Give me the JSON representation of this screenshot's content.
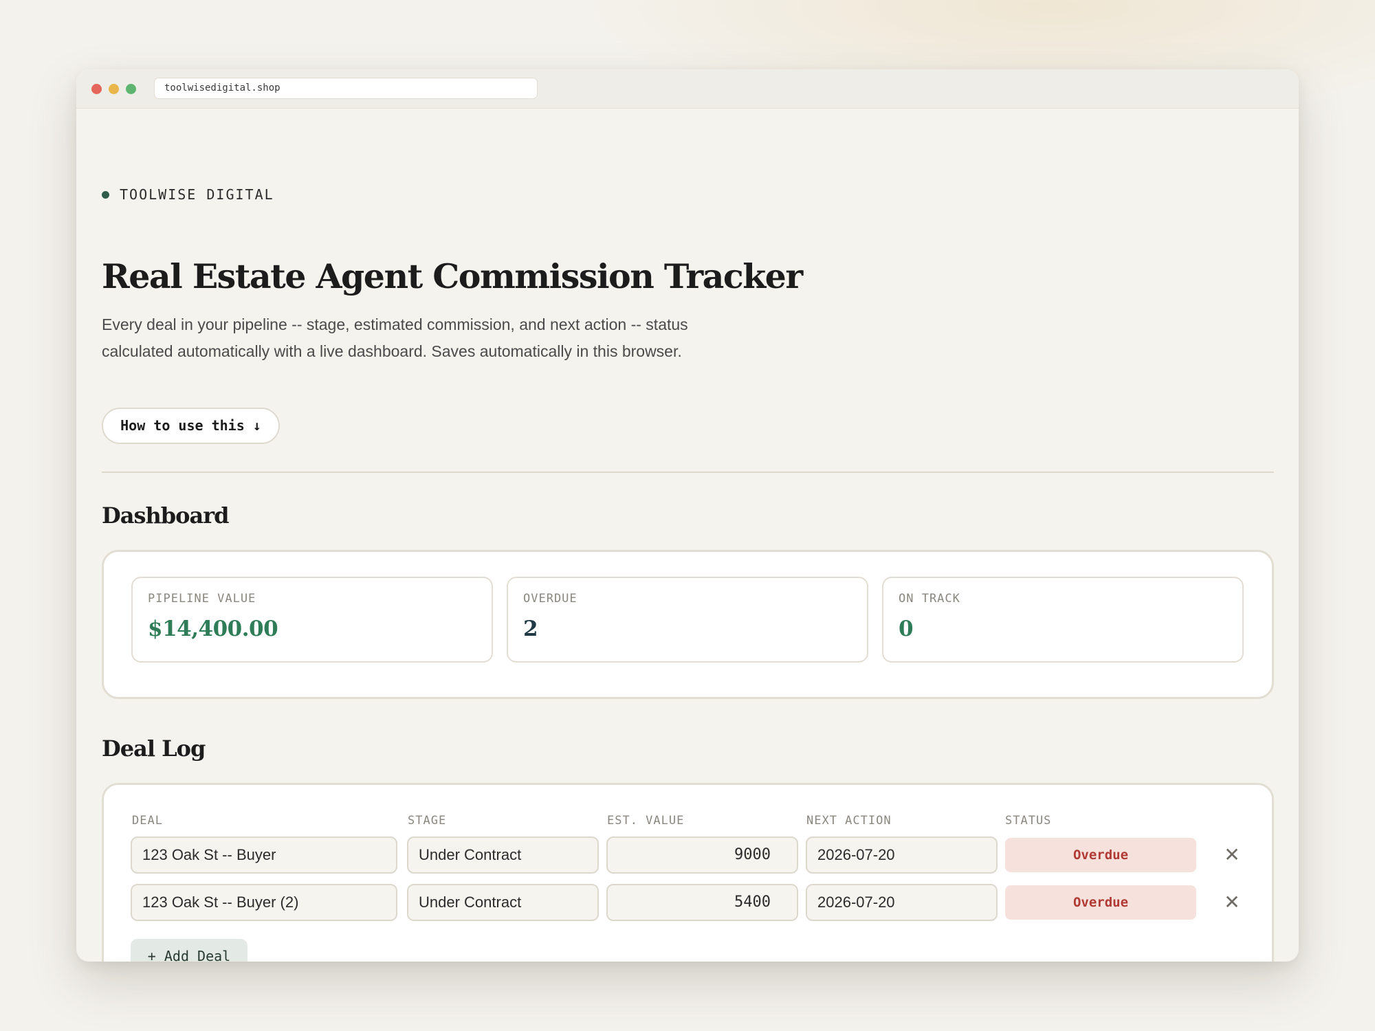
{
  "browser": {
    "url": "toolwisedigital.shop"
  },
  "header": {
    "brand": "TOOLWISE DIGITAL",
    "title": "Real Estate Agent Commission Tracker",
    "subtitle": "Every deal in your pipeline -- stage, estimated commission, and next action -- status calculated automatically with a live dashboard. Saves automatically in this browser.",
    "howto_label": "How to use this ↓"
  },
  "dashboard": {
    "title": "Dashboard",
    "stats": [
      {
        "label": "PIPELINE VALUE",
        "value": "$14,400.00",
        "color": "#2f7d58"
      },
      {
        "label": "OVERDUE",
        "value": "2",
        "color": "#1f3a44"
      },
      {
        "label": "ON TRACK",
        "value": "0",
        "color": "#2f7d58"
      }
    ]
  },
  "deal_log": {
    "title": "Deal Log",
    "columns": [
      "DEAL",
      "STAGE",
      "EST. VALUE",
      "NEXT ACTION",
      "STATUS"
    ],
    "rows": [
      {
        "deal": "123 Oak St -- Buyer",
        "stage": "Under Contract",
        "value": "9000",
        "next_action": "2026-07-20",
        "status": "Overdue"
      },
      {
        "deal": "123 Oak St -- Buyer (2)",
        "stage": "Under Contract",
        "value": "5400",
        "next_action": "2026-07-20",
        "status": "Overdue"
      }
    ],
    "remove_glyph": "✕",
    "add_label": "+ Add Deal"
  },
  "colors": {
    "accent_green": "#2f7d58",
    "overdue_red": "#b13a34",
    "overdue_bg": "#f6e1dc",
    "page_bg": "#f4f2ed"
  }
}
